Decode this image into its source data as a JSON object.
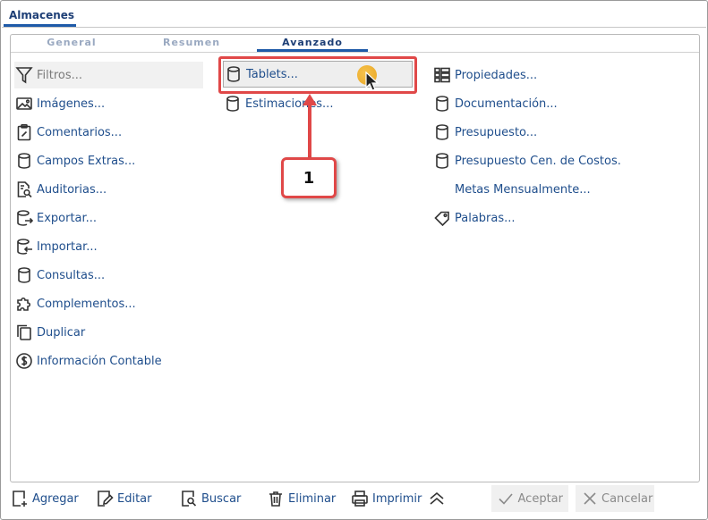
{
  "window": {
    "tab_label": "Almacenes"
  },
  "tabs": [
    {
      "label": "General"
    },
    {
      "label": "Resumen"
    },
    {
      "label": "Avanzado",
      "active": true
    }
  ],
  "column1": [
    {
      "label": "Filtros...",
      "icon": "filter-icon"
    },
    {
      "label": "Imágenes...",
      "icon": "image-icon"
    },
    {
      "label": "Comentarios...",
      "icon": "clipboard-edit-icon"
    },
    {
      "label": "Campos Extras...",
      "icon": "database-icon"
    },
    {
      "label": "Auditorias...",
      "icon": "document-search-icon"
    },
    {
      "label": "Exportar...",
      "icon": "database-export-icon"
    },
    {
      "label": "Importar...",
      "icon": "database-import-icon"
    },
    {
      "label": "Consultas...",
      "icon": "database-icon"
    },
    {
      "label": "Complementos...",
      "icon": "puzzle-icon"
    },
    {
      "label": "Duplicar",
      "icon": "copy-icon"
    },
    {
      "label": "Información Contable",
      "icon": "dollar-icon"
    }
  ],
  "column2": [
    {
      "label": "Tablets...",
      "icon": "database-icon",
      "selected": true
    },
    {
      "label": "Estimaciones...",
      "icon": "database-icon"
    }
  ],
  "column3": [
    {
      "label": "Propiedades...",
      "icon": "properties-grid-icon"
    },
    {
      "label": "Documentación...",
      "icon": "database-icon"
    },
    {
      "label": "Presupuesto...",
      "icon": "database-icon"
    },
    {
      "label": "Presupuesto Cen. de Costos.",
      "icon": "database-icon"
    },
    {
      "label": "Metas Mensualmente...",
      "icon": ""
    },
    {
      "label": "Palabras...",
      "icon": "tag-icon"
    }
  ],
  "annotation": {
    "step_number": "1",
    "color": "#e04848"
  },
  "footer": {
    "agregar": "Agregar",
    "editar": "Editar",
    "buscar": "Buscar",
    "eliminar": "Eliminar",
    "imprimir": "Imprimir",
    "aceptar": "Aceptar",
    "cancelar": "Cancelar"
  },
  "colors": {
    "link": "#1f4e8c",
    "tab_active": "#1e3f76",
    "tab_underline": "#1e5aa8",
    "accent_red": "#e04848"
  }
}
